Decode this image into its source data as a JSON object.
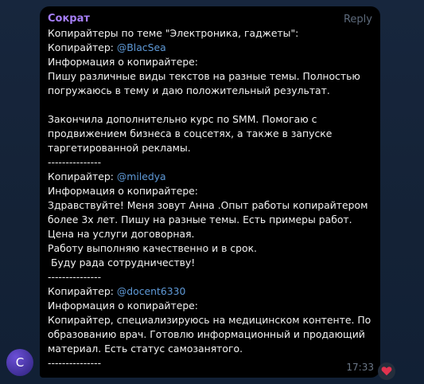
{
  "message": {
    "sender": "Сократ",
    "reply_label": "Reply",
    "time": "17:33",
    "avatar_letter": "C",
    "lines": [
      {
        "pre": "Копирайтеры по теме \"Электроника, гаджеты\":",
        "mention": "",
        "post": ""
      },
      {
        "pre": "Копирайтер: ",
        "mention": "@BlacSea",
        "post": ""
      },
      {
        "pre": "Информация о копирайтере:",
        "mention": "",
        "post": ""
      },
      {
        "pre": "Пишу различные виды текстов на разные темы. Полностью",
        "mention": "",
        "post": ""
      },
      {
        "pre": "погружаюсь в тему и даю положительный результат.",
        "mention": "",
        "post": ""
      },
      {
        "pre": "",
        "mention": "",
        "post": ""
      },
      {
        "pre": "Закончила дополнительно курс по SMM. Помогаю с",
        "mention": "",
        "post": ""
      },
      {
        "pre": "продвижением бизнеса в соцсетях, а также в запуске",
        "mention": "",
        "post": ""
      },
      {
        "pre": "таргетированной рекламы.",
        "mention": "",
        "post": ""
      },
      {
        "pre": "---------------",
        "mention": "",
        "post": ""
      },
      {
        "pre": "Копирайтер: ",
        "mention": "@miledya",
        "post": ""
      },
      {
        "pre": "Информация о копирайтере:",
        "mention": "",
        "post": ""
      },
      {
        "pre": "Здравствуйте! Меня зовут Анна .Опыт работы копирайтером",
        "mention": "",
        "post": ""
      },
      {
        "pre": "более 3х лет. Пишу на разные темы. Есть примеры работ.",
        "mention": "",
        "post": ""
      },
      {
        "pre": "Цена на услуги договорная.",
        "mention": "",
        "post": ""
      },
      {
        "pre": "Работу выполняю качественно и в срок.",
        "mention": "",
        "post": ""
      },
      {
        "pre": " Буду рада сотрудничеству!",
        "mention": "",
        "post": ""
      },
      {
        "pre": "---------------",
        "mention": "",
        "post": ""
      },
      {
        "pre": "Копирайтер: ",
        "mention": "@docent6330",
        "post": ""
      },
      {
        "pre": "Информация о копирайтере:",
        "mention": "",
        "post": ""
      },
      {
        "pre": "Копирайтер, специализируюсь на медицинском контенте. По",
        "mention": "",
        "post": ""
      },
      {
        "pre": "образованию врач. Готовлю информационный и продающий",
        "mention": "",
        "post": ""
      },
      {
        "pre": "материал. Есть статус самозанятого.",
        "mention": "",
        "post": ""
      },
      {
        "pre": "---------------",
        "mention": "",
        "post": ""
      }
    ]
  },
  "reaction": {
    "icon": "heart-icon",
    "color": "#e0334f"
  },
  "colors": {
    "sender": "#a57ef5",
    "mention": "#5f9ad8",
    "bubble": "#000000"
  }
}
